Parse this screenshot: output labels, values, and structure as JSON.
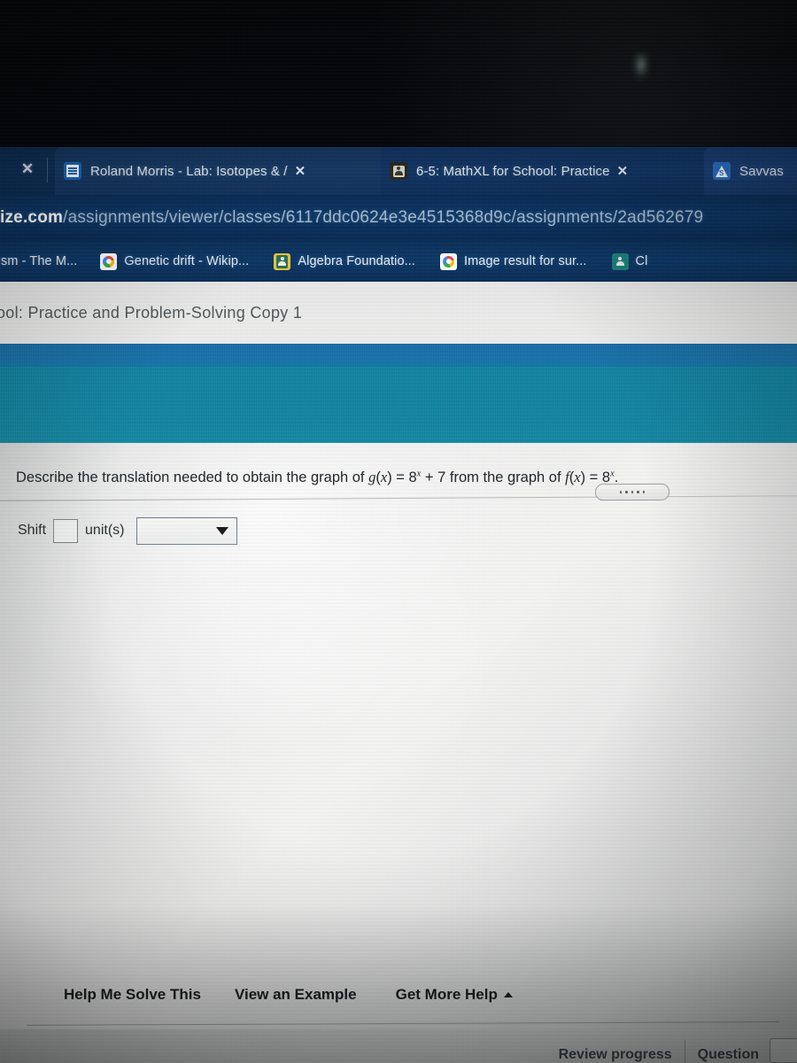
{
  "browser": {
    "strip_close_label": "✕",
    "tabs": [
      {
        "title": "Roland Morris - Lab: Isotopes & /",
        "favicon": "document-icon",
        "close_label": "✕"
      },
      {
        "title": "6-5: MathXL for School: Practice",
        "favicon": "person-badge-icon",
        "close_label": "✕"
      },
      {
        "title": "Savvas",
        "favicon": "savvas-s-icon",
        "close_label": ""
      }
    ],
    "url": {
      "domain": "ize.com",
      "path": "/assignments/viewer/classes/6117ddc0624e3e4515368d9c/assignments/2ad562679"
    },
    "bookmarks": [
      {
        "label": "ealism - The M...",
        "icon": "none"
      },
      {
        "label": "Genetic drift - Wikip...",
        "icon": "google-icon"
      },
      {
        "label": "Algebra Foundatio...",
        "icon": "classroom-person-icon"
      },
      {
        "label": "Image result for sur...",
        "icon": "google-icon"
      },
      {
        "label": "Cl",
        "icon": "classroom-person-teal-icon"
      }
    ]
  },
  "page": {
    "title": "ool: Practice and Problem-Solving Copy 1"
  },
  "exercise": {
    "question": {
      "part1": "Describe the translation needed to obtain the graph of ",
      "g_name": "g",
      "g_open": "(",
      "g_var": "x",
      "g_close": ") = 8",
      "g_exp": "x",
      "g_rest": " + 7 from the graph of ",
      "f_name": "f",
      "f_open": "(",
      "f_var": "x",
      "f_close": ") = 8",
      "f_exp": "x",
      "f_end": ".",
      "full_text": "Describe the translation needed to obtain the graph of g(x) = 8^x + 7 from the graph of f(x) = 8^x."
    },
    "more_button_label": "•••••",
    "answer": {
      "prefix_label": "Shift",
      "input_value": "",
      "unit_label": "unit(s)",
      "direction_value": "",
      "direction_caret": "▼"
    }
  },
  "help": {
    "links": [
      {
        "label": "Help Me Solve This",
        "caret": ""
      },
      {
        "label": "View an Example",
        "caret": ""
      },
      {
        "label": "Get More Help",
        "caret": "▲"
      }
    ]
  },
  "footer": {
    "review_progress_label": "Review progress",
    "question_label": "Question"
  },
  "colors": {
    "chrome_blue": "#0d3561",
    "tab_blue": "#173a63",
    "banner_teal": "#17839f",
    "banner_blue": "#1d6ca4",
    "page_gray": "#f2f2f1",
    "text_dark": "#21262a"
  }
}
